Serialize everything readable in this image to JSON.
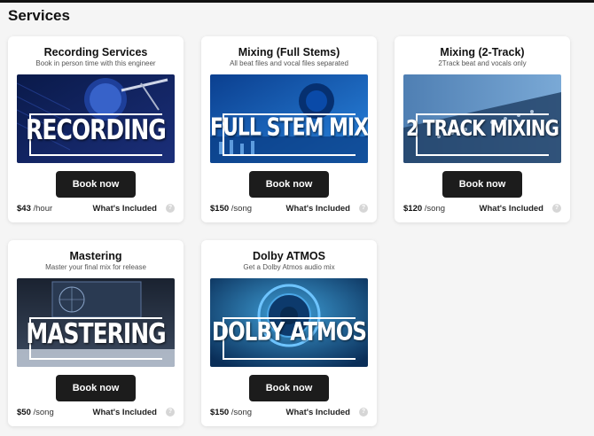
{
  "page": {
    "title": "Services"
  },
  "cards": [
    {
      "title": "Recording Services",
      "subtitle": "Book in person time with this engineer",
      "image_text": "RECORDING",
      "button": "Book now",
      "price": "$43",
      "unit": "/hour",
      "included": "What's Included",
      "help_glyph": "?"
    },
    {
      "title": "Mixing (Full Stems)",
      "subtitle": "All beat files and vocal files separated",
      "image_text": "FULL STEM MIX",
      "button": "Book now",
      "price": "$150",
      "unit": "/song",
      "included": "What's Included",
      "help_glyph": "?"
    },
    {
      "title": "Mixing (2-Track)",
      "subtitle": "2Track beat and vocals only",
      "image_text": "2 TRACK MIXING",
      "button": "Book now",
      "price": "$120",
      "unit": "/song",
      "included": "What's Included",
      "help_glyph": "?"
    },
    {
      "title": "Mastering",
      "subtitle": "Master your final mix for release",
      "image_text": "MASTERING",
      "button": "Book now",
      "price": "$50",
      "unit": "/song",
      "included": "What's Included",
      "help_glyph": "?"
    },
    {
      "title": "Dolby ATMOS",
      "subtitle": "Get a Dolby Atmos audio mix",
      "image_text": "DOLBY ATMOS",
      "button": "Book now",
      "price": "$150",
      "unit": "/song",
      "included": "What's Included",
      "help_glyph": "?"
    }
  ],
  "colors": {
    "button_bg": "#1c1c1c",
    "page_bg": "#f5f5f5",
    "card_bg": "#ffffff"
  }
}
